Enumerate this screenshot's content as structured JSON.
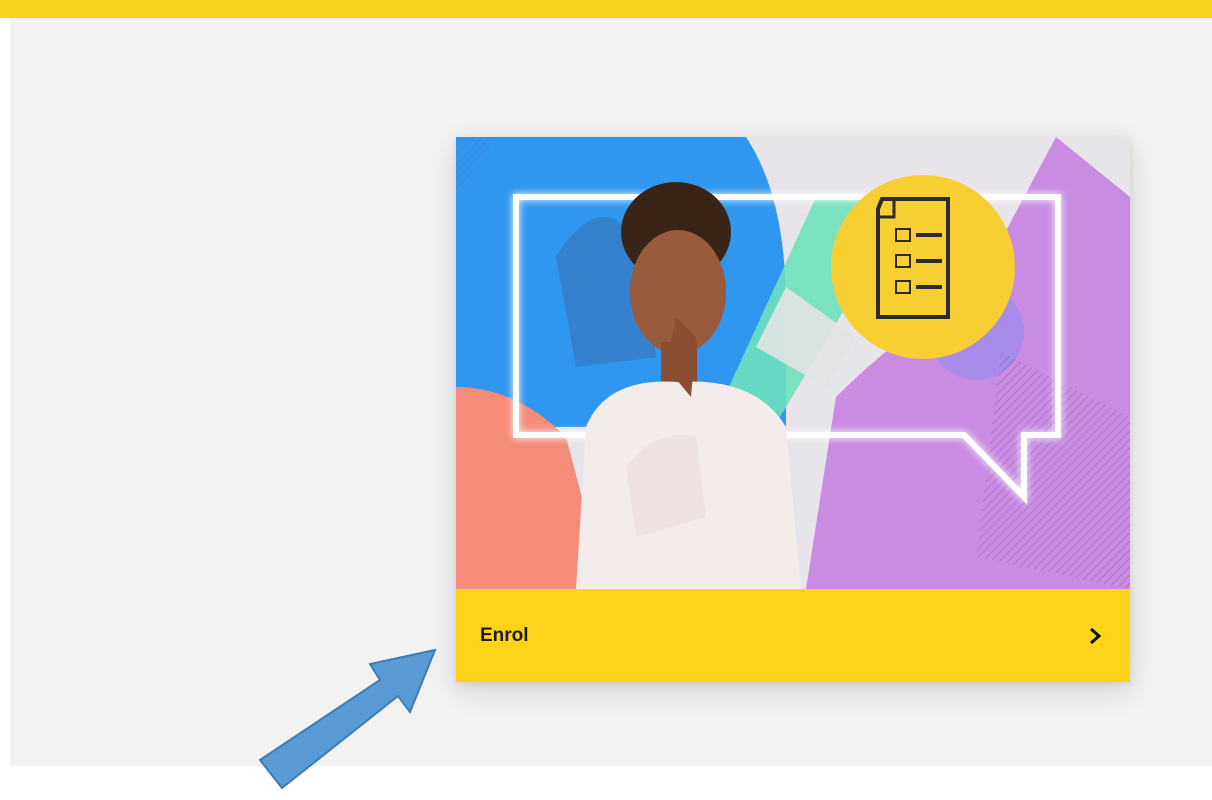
{
  "top_bar": {
    "color": "#f8d21c"
  },
  "card": {
    "image_icon": "checklist-document-icon",
    "button": {
      "label": "Enrol",
      "icon": "chevron-right-icon",
      "color": "#fdd41a"
    }
  },
  "annotation": {
    "icon": "blue-pointer-arrow",
    "color": "#5b9bd5"
  }
}
